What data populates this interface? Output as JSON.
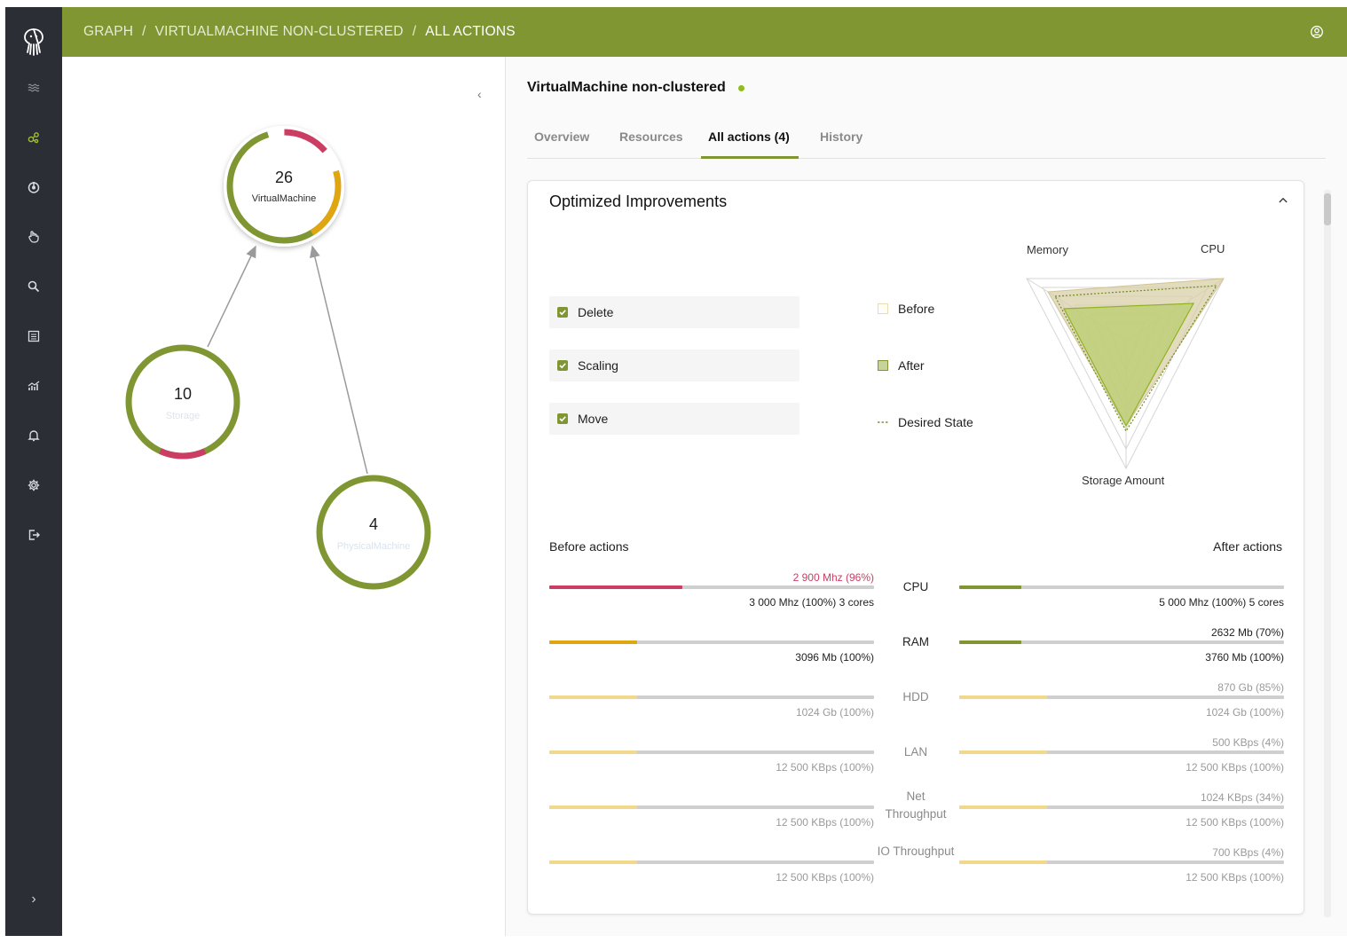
{
  "header": {
    "breadcrumb": [
      "GRAPH",
      "VIRTUALMACHINE NON-CLUSTERED",
      "ALL ACTIONS"
    ],
    "separator": "/"
  },
  "sidebar": {
    "icons": [
      "waves-icon",
      "graph-icon",
      "power-icon",
      "hand-icon",
      "search-icon",
      "list-icon",
      "analytics-icon",
      "bell-icon",
      "gear-icon",
      "logout-icon"
    ],
    "active_index": 1
  },
  "graph": {
    "nodes": [
      {
        "count": "26",
        "label": "VirtualMachine"
      },
      {
        "count": "10",
        "label": "Storage"
      },
      {
        "count": "4",
        "label": "PhysicalMachine"
      }
    ]
  },
  "detail": {
    "title": "VirtualMachine non-clustered",
    "tabs": [
      "Overview",
      "Resources",
      "All actions (4)",
      "History"
    ],
    "active_tab": 2,
    "card_title": "Optimized Improvements",
    "actions": [
      "Delete",
      "Scaling",
      "Move"
    ],
    "legend": [
      "Before",
      "After",
      "Desired State"
    ],
    "radar_axes": [
      "Memory",
      "CPU",
      "Storage Amount"
    ],
    "before_label": "Before actions",
    "after_label": "After actions",
    "metrics": [
      {
        "name": "CPU",
        "before_top": "2 900 Mhz (96%)",
        "before_bottom": "3 000 Mhz (100%) 3 cores",
        "before_fill": 0.41,
        "after_top": "",
        "after_bottom": "5 000 Mhz (100%) 5 cores",
        "after_fill": 0.19
      },
      {
        "name": "RAM",
        "before_top": "",
        "before_bottom": "3096 Mb (100%)",
        "before_fill": 0.27,
        "after_top": "2632 Mb (70%)",
        "after_bottom": "3760 Mb (100%)",
        "after_fill": 0.19
      },
      {
        "name": "HDD",
        "before_top": "",
        "before_bottom": "1024 Gb (100%)",
        "before_fill": 0.27,
        "after_top": "870 Gb (85%)",
        "after_bottom": "1024 Gb (100%)",
        "after_fill": 0.27
      },
      {
        "name": "LAN",
        "before_top": "",
        "before_bottom": "12 500 KBps (100%)",
        "before_fill": 0.27,
        "after_top": "500 KBps (4%)",
        "after_bottom": "12 500 KBps (100%)",
        "after_fill": 0.27
      },
      {
        "name": "Net Throughput",
        "before_top": "",
        "before_bottom": "12 500 KBps (100%)",
        "before_fill": 0.27,
        "after_top": "1024 KBps (34%)",
        "after_bottom": "12 500 KBps (100%)",
        "after_fill": 0.27
      },
      {
        "name": "IO Throughput",
        "before_top": "",
        "before_bottom": "12 500 KBps (100%)",
        "before_fill": 0.27,
        "after_top": "700 KBps (4%)",
        "after_bottom": "12 500 KBps (100%)",
        "after_fill": 0.27
      }
    ]
  },
  "colors": {
    "accent": "#7f9633",
    "sidebar": "#2c2e36",
    "red": "#cc3d63",
    "amber": "#e0a612",
    "light_yellow": "#f2d88a"
  }
}
